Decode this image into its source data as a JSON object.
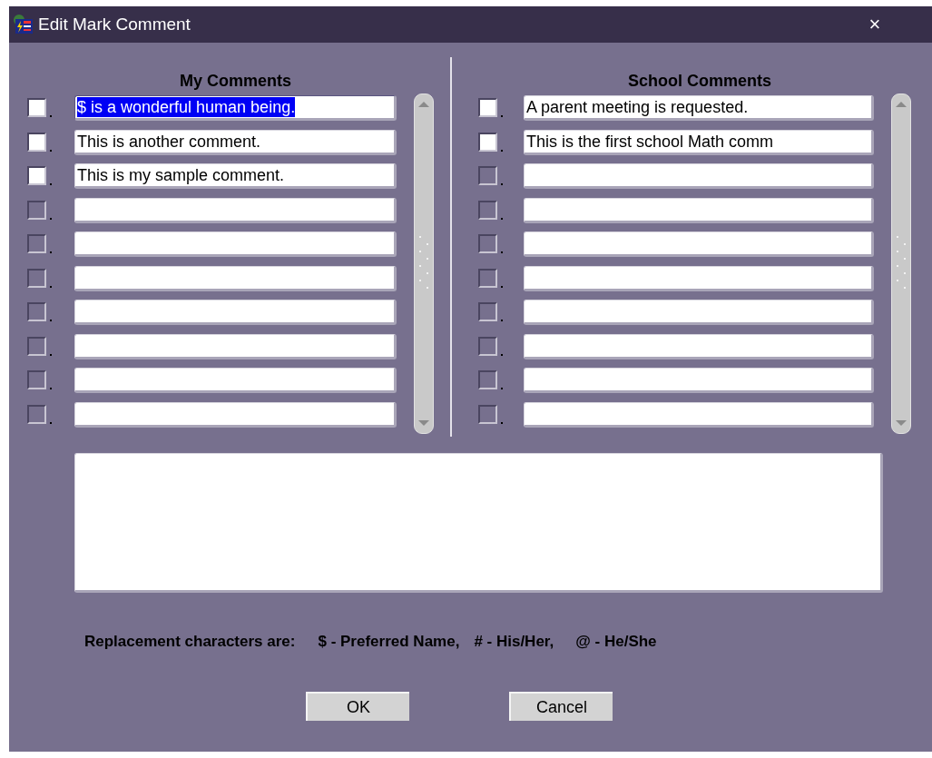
{
  "window": {
    "title": "Edit Mark Comment",
    "close": "×"
  },
  "panels": [
    {
      "heading": "My Comments",
      "rows": [
        {
          "text": "$ is a wonderful human being.",
          "enabled": true,
          "checked": false,
          "selected": true
        },
        {
          "text": "This is another comment.",
          "enabled": true,
          "checked": false,
          "selected": false
        },
        {
          "text": "This is my sample comment.",
          "enabled": true,
          "checked": false,
          "selected": false
        },
        {
          "enabled": false,
          "checked": false,
          "selected": false
        },
        {
          "enabled": false,
          "checked": false,
          "selected": false
        },
        {
          "enabled": false,
          "checked": false,
          "selected": false
        },
        {
          "enabled": false,
          "checked": false,
          "selected": false
        },
        {
          "enabled": false,
          "checked": false,
          "selected": false
        },
        {
          "enabled": false,
          "checked": false,
          "selected": false
        },
        {
          "enabled": false,
          "checked": false,
          "selected": false
        }
      ]
    },
    {
      "heading": "School Comments",
      "rows": [
        {
          "text": "A parent meeting is requested.",
          "enabled": true,
          "checked": false,
          "selected": false
        },
        {
          "text": "This is the first school Math comm",
          "enabled": true,
          "checked": false,
          "selected": false
        },
        {
          "enabled": false,
          "checked": false,
          "selected": false
        },
        {
          "enabled": false,
          "checked": false,
          "selected": false
        },
        {
          "enabled": false,
          "checked": false,
          "selected": false
        },
        {
          "enabled": false,
          "checked": false,
          "selected": false
        },
        {
          "enabled": false,
          "checked": false,
          "selected": false
        },
        {
          "enabled": false,
          "checked": false,
          "selected": false
        },
        {
          "enabled": false,
          "checked": false,
          "selected": false
        },
        {
          "enabled": false,
          "checked": false,
          "selected": false
        }
      ]
    }
  ],
  "replacement_note": [
    "Replacement characters are:",
    "$ - Preferred Name,",
    "# - His/Her,",
    "@ - He/She"
  ],
  "buttons": [
    "OK",
    "Cancel"
  ]
}
